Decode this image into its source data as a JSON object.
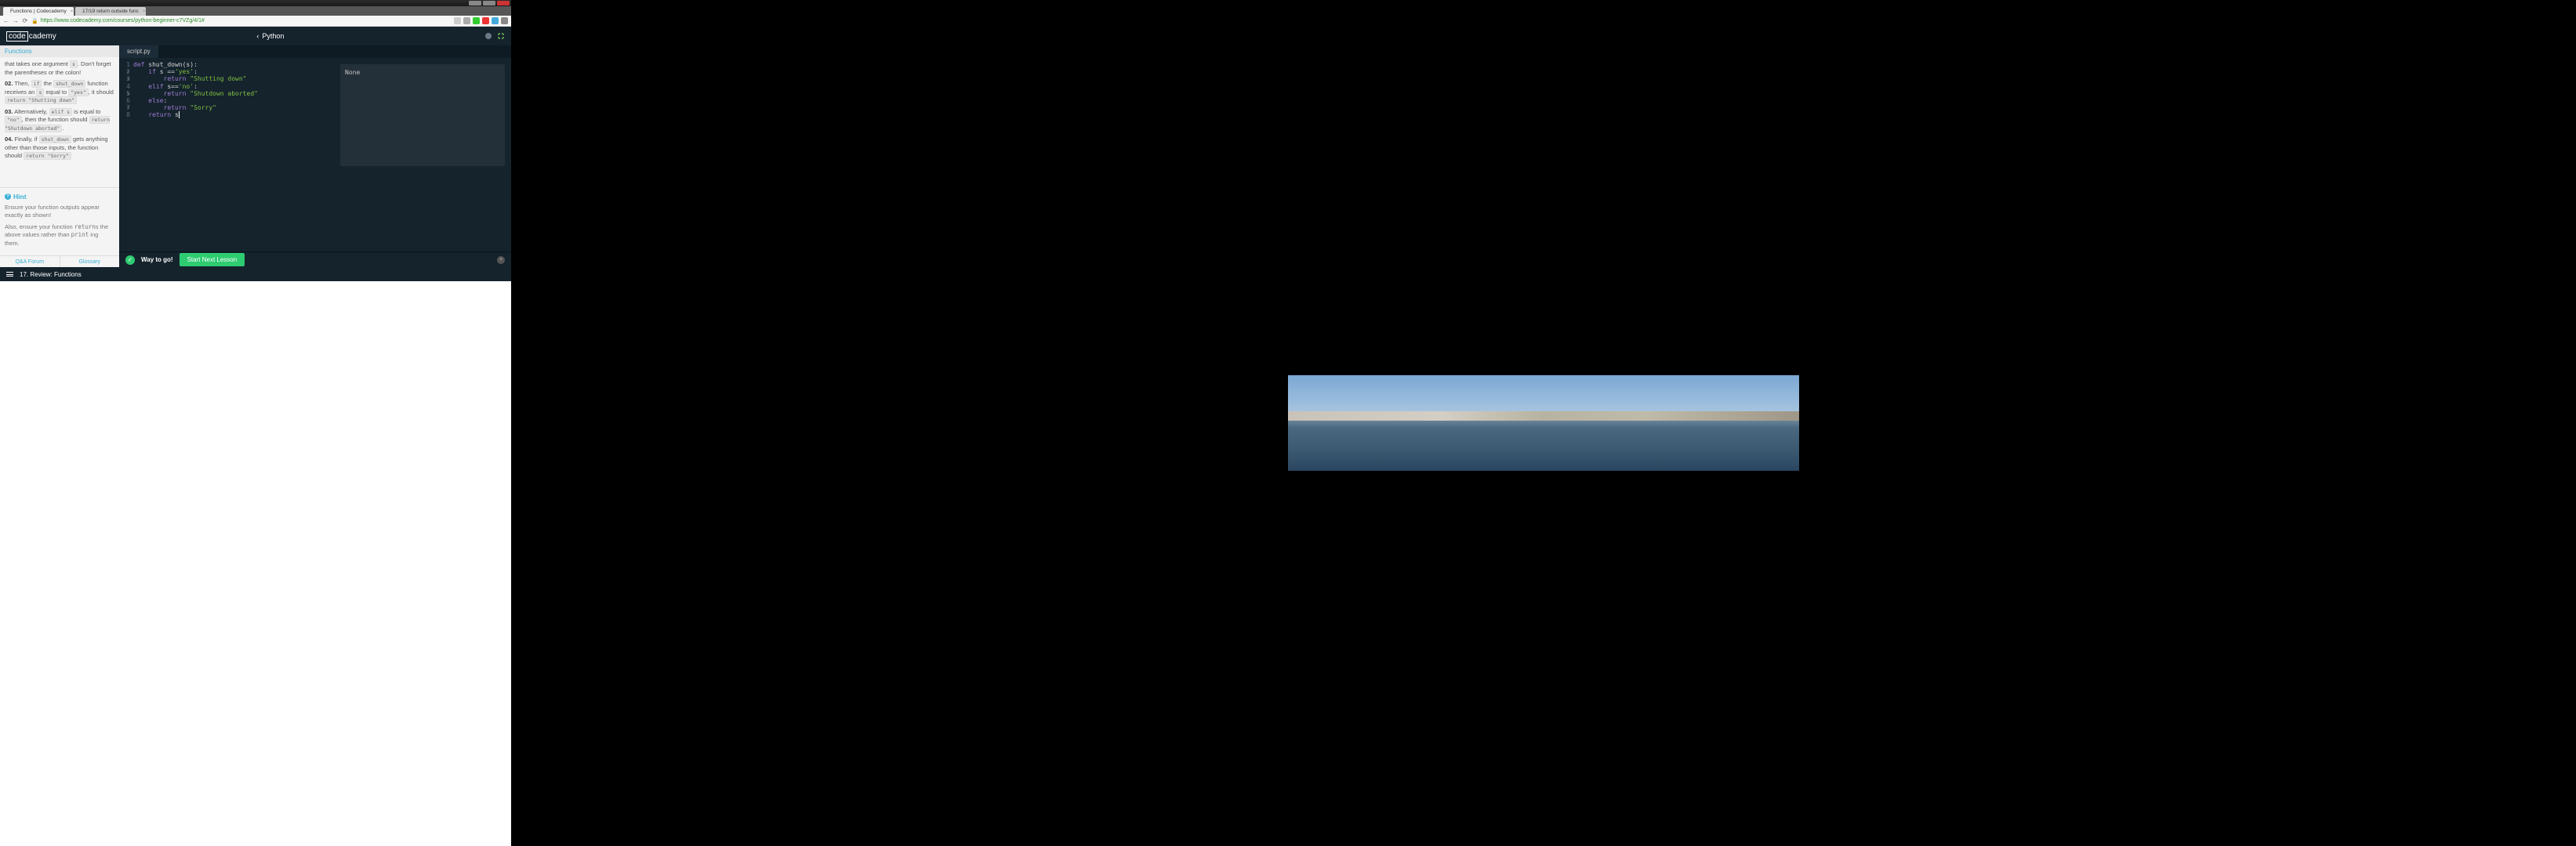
{
  "window": {
    "tabs": [
      {
        "title": "Functions | Codecademy"
      },
      {
        "title": "17/19 return outside func"
      }
    ],
    "url": "https://www.codecademy.com/courses/python-beginner-c7VZg/4/1#"
  },
  "header": {
    "logo_box": "code",
    "logo_rest": "cademy",
    "breadcrumb_back_icon": "‹",
    "breadcrumb": "Python"
  },
  "sidebar": {
    "title": "Functions",
    "inst_01_pre": "that takes one argument ",
    "inst_01_code": "s",
    "inst_01_post": ". Don't forget the parentheses or the colon!",
    "inst_02_num": "02.",
    "inst_02_a": " Then, ",
    "inst_02_code1": "if",
    "inst_02_b": " the ",
    "inst_02_code2": "shut_down",
    "inst_02_c": " function receives an ",
    "inst_02_code3": "s",
    "inst_02_d": " equal to ",
    "inst_02_code4": "\"yes\"",
    "inst_02_e": ", it should ",
    "inst_02_code5": "return \"Shutting down\"",
    "inst_03_num": "03.",
    "inst_03_a": " Alternatively, ",
    "inst_03_code1": "elif s",
    "inst_03_b": " is equal to ",
    "inst_03_code2": "\"no\"",
    "inst_03_c": ", then the function should ",
    "inst_03_code3": "return \"Shutdown aborted\"",
    "inst_03_d": ".",
    "inst_04_num": "04.",
    "inst_04_a": " Finally, if ",
    "inst_04_code1": "shut_down",
    "inst_04_b": " gets anything other than those inputs, the function should ",
    "inst_04_code2": "return \"Sorry\"",
    "hint_title": "Hint",
    "hint_p1": "Ensure your function outputs appear exactly as shown!",
    "hint_p2a": "Also, ensure your function ",
    "hint_p2_code1": "return",
    "hint_p2b": "s the above values rather than ",
    "hint_p2_code2": "print",
    "hint_p2c": " ing them.",
    "footer_qa": "Q&A Forum",
    "footer_glossary": "Glossary"
  },
  "editor": {
    "tab": "script.py",
    "gutter": [
      "1",
      "2",
      "3",
      "4",
      "5",
      "6",
      "7",
      "8"
    ],
    "fold_markers": [
      "▾",
      "▾",
      "",
      "▾",
      "",
      "▾",
      "",
      ""
    ],
    "line1_kw": "def",
    "line1_rest": " shut_down(s):",
    "line2_kw": "if",
    "line2_rest": " s ==",
    "line2_str": "'yes'",
    "line2_colon": ":",
    "line3_kw": "return",
    "line3_str": " \"Shutting down\"",
    "line4_kw": "elif",
    "line4_rest": " s==",
    "line4_str": "'no'",
    "line4_colon": ":",
    "line5_kw": "return",
    "line5_str": " \"Shutdown aborted\"",
    "line6_kw": "else",
    "line6_colon": ":",
    "line7_kw": "return",
    "line7_str": " \"Sorry\"",
    "line8_kw": "return",
    "line8_rest": " s"
  },
  "output": {
    "text": "None"
  },
  "success": {
    "text": "Way to go!",
    "button": "Start Next Lesson"
  },
  "bottom": {
    "lesson": "17. Review: Functions"
  }
}
